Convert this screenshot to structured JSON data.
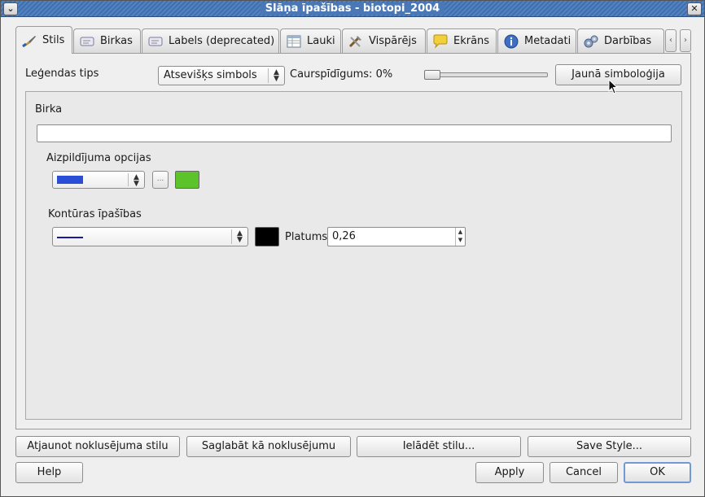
{
  "window": {
    "title": "Slāņa īpašības - biotopi_2004",
    "menu_btn": "⌄",
    "close_btn": "✕"
  },
  "tabs": [
    {
      "label": "Stils",
      "icon": "brush-icon",
      "active": true
    },
    {
      "label": "Birkas",
      "icon": "label-icon"
    },
    {
      "label": "Labels (deprecated)",
      "icon": "label-icon"
    },
    {
      "label": "Lauki",
      "icon": "table-icon"
    },
    {
      "label": "Vispārējs",
      "icon": "tools-icon"
    },
    {
      "label": "Ekrāns",
      "icon": "speech-bubble-icon"
    },
    {
      "label": "Metadati",
      "icon": "info-icon"
    },
    {
      "label": "Darbības",
      "icon": "gears-icon"
    }
  ],
  "tab_scroll": {
    "left": "‹",
    "right": "›"
  },
  "style": {
    "legend_type_label": "Leģendas tips",
    "legend_type_value": "Atsevišķs simbols",
    "transparency_label": "Caurspīdīgums: 0%",
    "transparency_value": 0,
    "new_symbology_button": "Jaunā simboloģija",
    "tag_label": "Birka",
    "tag_value": "",
    "fill_options_label": "Aizpildījuma opcijas",
    "fill_pattern_color": "#2a4fd6",
    "browse_button": "...",
    "fill_color": "#5cc32a",
    "outline_label": "Kontūras īpašības",
    "outline_line_color": "#1a1aa0",
    "outline_color": "#000000",
    "width_label": "Platums",
    "width_value": "0,26"
  },
  "bottom_buttons": {
    "restore_default": "Atjaunot noklusējuma stilu",
    "save_as_default": "Saglabāt kā noklusējumu",
    "load_style": "Ielādēt stilu...",
    "save_style": "Save Style..."
  },
  "dialog_buttons": {
    "help": "Help",
    "apply": "Apply",
    "cancel": "Cancel",
    "ok": "OK"
  }
}
